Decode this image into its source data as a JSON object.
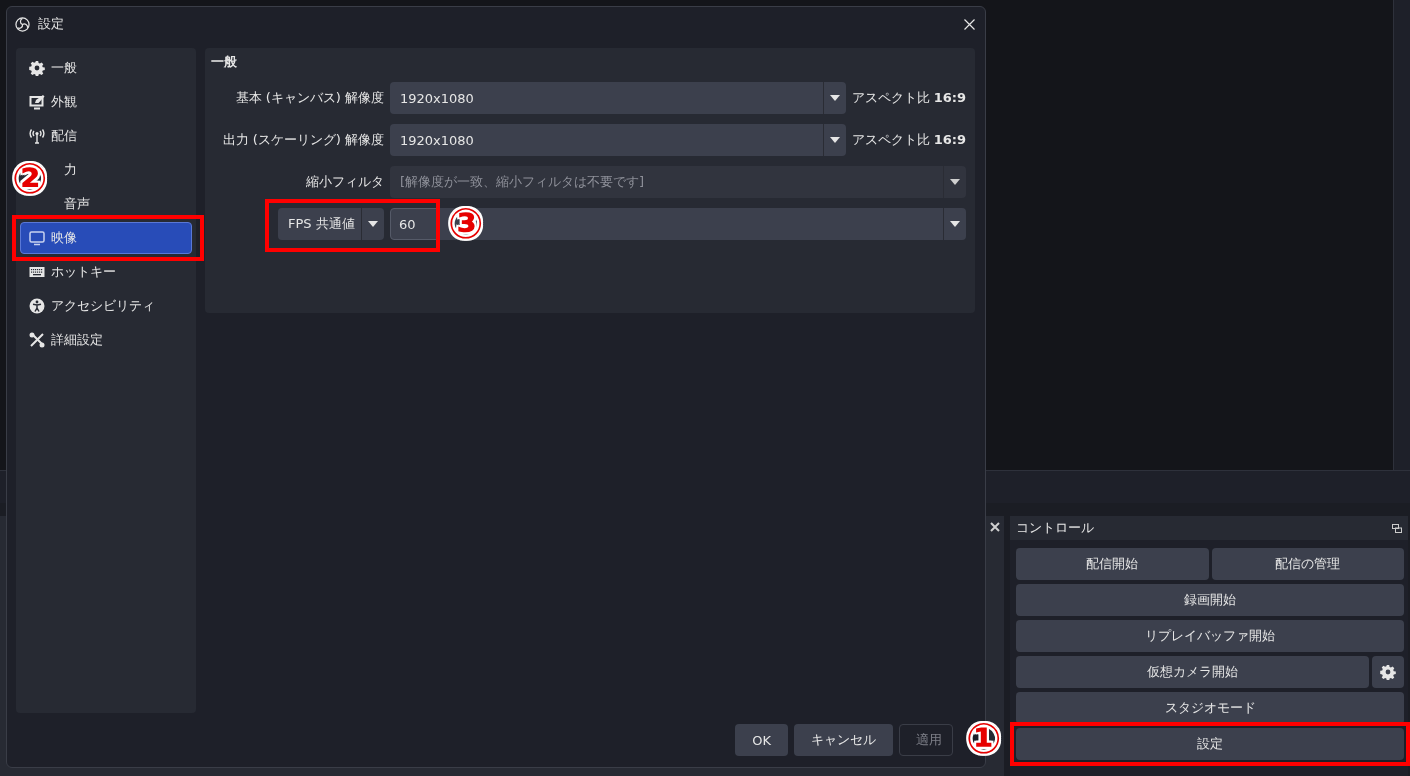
{
  "window": {
    "title": "設定"
  },
  "sidebar": {
    "items": [
      {
        "label": "一般",
        "selected": false,
        "highlighted": false
      },
      {
        "label": "外観",
        "selected": false,
        "highlighted": false
      },
      {
        "label": "配信",
        "selected": false,
        "highlighted": false
      },
      {
        "label": "力",
        "selected": false,
        "highlighted": false
      },
      {
        "label": "音声",
        "selected": false,
        "highlighted": false
      },
      {
        "label": "映像",
        "selected": true,
        "highlighted": true
      },
      {
        "label": "ホットキー",
        "selected": false,
        "highlighted": false
      },
      {
        "label": "アクセシビリティ",
        "selected": false,
        "highlighted": false
      },
      {
        "label": "詳細設定",
        "selected": false,
        "highlighted": false
      }
    ]
  },
  "form": {
    "heading": "一般",
    "rows": [
      {
        "kind": "combo",
        "label": "基本 (キャンバス) 解像度",
        "value": "1920x1080",
        "aspect": "アスペクト比 **16:9**",
        "disabled": false
      },
      {
        "kind": "combo",
        "label": "出力 (スケーリング) 解像度",
        "value": "1920x1080",
        "aspect": "アスペクト比 **16:9**",
        "disabled": false
      },
      {
        "kind": "combo",
        "label": "縮小フィルタ",
        "value": "[解像度が一致、縮小フィルタは不要です]",
        "disabled": true
      },
      {
        "kind": "fps",
        "type_value": "FPS 共通値",
        "value": "60",
        "highlighted": true
      }
    ]
  },
  "buttons": [
    {
      "label": "OK",
      "disabled": false
    },
    {
      "label": "キャンセル",
      "disabled": false
    },
    {
      "label": "適用",
      "disabled": true
    }
  ],
  "controls": {
    "title": "コントロール",
    "rows": [
      [
        {
          "kind": "text",
          "label": "配信開始",
          "highlighted": false
        },
        {
          "kind": "text",
          "label": "配信の管理",
          "highlighted": false
        }
      ],
      [
        {
          "kind": "text",
          "label": "録画開始",
          "highlighted": false
        }
      ],
      [
        {
          "kind": "text",
          "label": "リプレイバッファ開始",
          "highlighted": false
        }
      ],
      [
        {
          "kind": "text",
          "label": "仮想カメラ開始",
          "highlighted": false
        },
        {
          "kind": "gear"
        }
      ],
      [
        {
          "kind": "text",
          "label": "スタジオモード",
          "highlighted": false
        }
      ],
      [
        {
          "kind": "text",
          "label": "設定",
          "highlighted": true
        }
      ]
    ]
  },
  "annotations": [
    {
      "label": "②"
    },
    {
      "label": "③"
    },
    {
      "label": "①"
    }
  ]
}
